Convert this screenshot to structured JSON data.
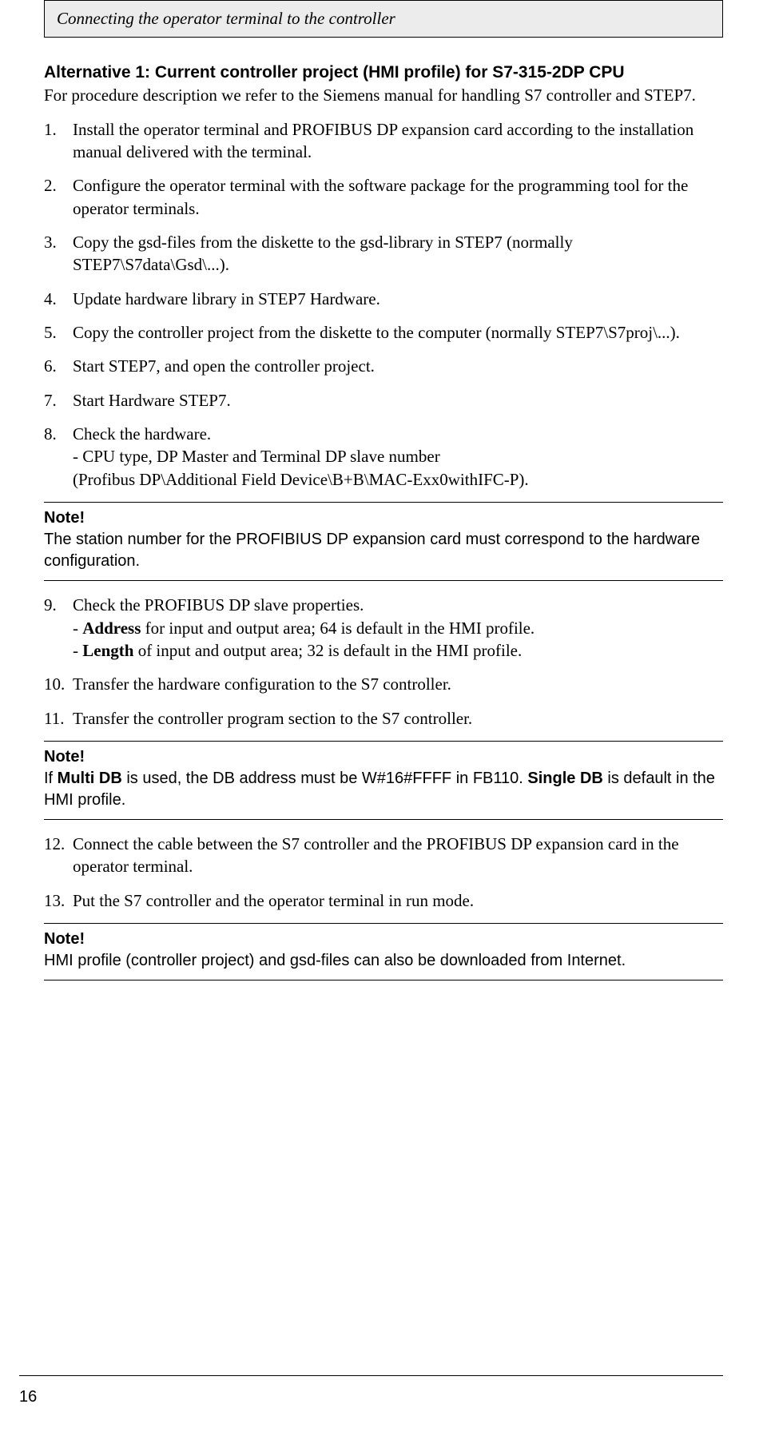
{
  "header": "Connecting the operator terminal to the controller",
  "title": "Alternative 1: Current controller project (HMI profile) for S7-315-2DP CPU",
  "intro": "For procedure description we refer to the Siemens manual for handling S7 controller and STEP7.",
  "steps_a": [
    {
      "n": "1.",
      "text": "Install the operator terminal and PROFIBUS DP expansion card according to the installation manual delivered with the terminal."
    },
    {
      "n": "2.",
      "text": "Configure the operator terminal with the software package for the programming tool for the operator terminals."
    },
    {
      "n": "3.",
      "text": "Copy the gsd-files from the diskette to the gsd-library in STEP7 (normally STEP7\\S7data\\Gsd\\...)."
    },
    {
      "n": "4.",
      "text": "Update hardware library in STEP7 Hardware."
    },
    {
      "n": "5.",
      "text": "Copy the controller project from the diskette to the computer (normally STEP7\\S7proj\\...)."
    },
    {
      "n": "6.",
      "text": "Start STEP7, and open the controller project."
    },
    {
      "n": "7.",
      "text": "Start Hardware STEP7."
    }
  ],
  "step8": {
    "n": "8.",
    "line1": "Check the hardware.",
    "line2": "- CPU type, DP Master and Terminal DP slave number",
    "line3": "(Profibus DP\\Additional Field Device\\B+B\\MAC-Exx0withIFC-P)."
  },
  "note1": {
    "label": "Note!",
    "text": "The station number for the PROFIBIUS DP expansion card must correspond to the hardware configuration."
  },
  "step9": {
    "n": "9.",
    "line1": "Check the PROFIBUS DP slave properties.",
    "line2_pre": "- ",
    "line2_bold": "Address",
    "line2_post": " for input and output area; 64 is default in the HMI profile.",
    "line3_pre": "- ",
    "line3_bold": "Length",
    "line3_post": " of input and output area; 32 is default in the HMI profile."
  },
  "steps_b": [
    {
      "n": "10.",
      "text": "Transfer the hardware configuration to the S7 controller."
    },
    {
      "n": "11.",
      "text": "Transfer the controller program section to the S7 controller."
    }
  ],
  "note2": {
    "label": "Note!",
    "pre": "If ",
    "b1": "Multi DB",
    "mid": " is used, the DB address must be W#16#FFFF in FB110. ",
    "b2": "Single DB",
    "post": " is default in the HMI profile."
  },
  "steps_c": [
    {
      "n": "12.",
      "text": "Connect the cable between the S7 controller and the PROFIBUS DP expansion card in the operator terminal."
    },
    {
      "n": "13.",
      "text": "Put the S7 controller and the operator terminal in run mode."
    }
  ],
  "note3": {
    "label": "Note!",
    "text": "HMI profile (controller project) and gsd-files can also be downloaded from Internet."
  },
  "page_number": "16"
}
